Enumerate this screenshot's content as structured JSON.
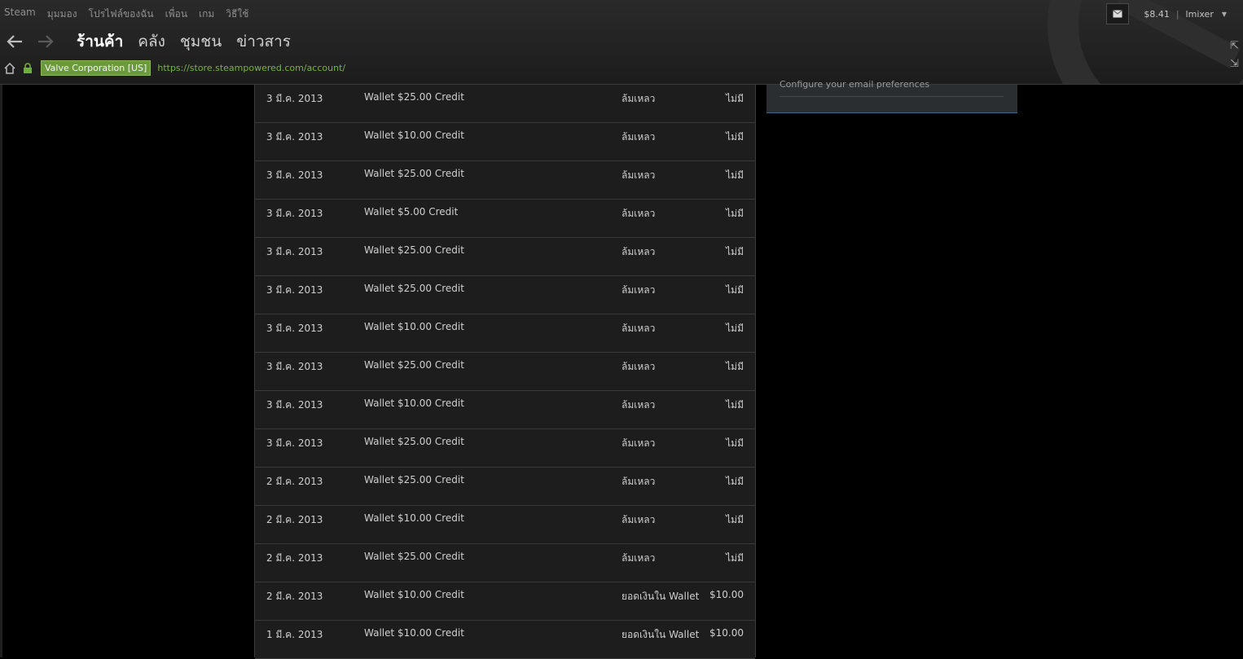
{
  "menubar": [
    "Steam",
    "มุมมอง",
    "โปรไฟล์ของฉัน",
    "เพื่อน",
    "เกม",
    "วิธีใช้"
  ],
  "account": {
    "balance": "$8.41",
    "separator": "|",
    "username": "lmixer"
  },
  "nav": {
    "tabs": [
      "ร้านค้า",
      "คลัง",
      "ชุมชน",
      "ข่าวสาร"
    ]
  },
  "urlbar": {
    "cert": "Valve Corporation [US]",
    "url": "https://store.steampowered.com/account/"
  },
  "right_panel": {
    "text": "Configure your email preferences"
  },
  "transactions": [
    {
      "date": "3 มี.ค. 2013",
      "item": "Wallet $25.00 Credit",
      "status": "ล้มเหลว",
      "amount": "ไม่มี"
    },
    {
      "date": "3 มี.ค. 2013",
      "item": "Wallet $10.00 Credit",
      "status": "ล้มเหลว",
      "amount": "ไม่มี"
    },
    {
      "date": "3 มี.ค. 2013",
      "item": "Wallet $25.00 Credit",
      "status": "ล้มเหลว",
      "amount": "ไม่มี"
    },
    {
      "date": "3 มี.ค. 2013",
      "item": "Wallet $5.00 Credit",
      "status": "ล้มเหลว",
      "amount": "ไม่มี"
    },
    {
      "date": "3 มี.ค. 2013",
      "item": "Wallet $25.00 Credit",
      "status": "ล้มเหลว",
      "amount": "ไม่มี"
    },
    {
      "date": "3 มี.ค. 2013",
      "item": "Wallet $25.00 Credit",
      "status": "ล้มเหลว",
      "amount": "ไม่มี"
    },
    {
      "date": "3 มี.ค. 2013",
      "item": "Wallet $10.00 Credit",
      "status": "ล้มเหลว",
      "amount": "ไม่มี"
    },
    {
      "date": "3 มี.ค. 2013",
      "item": "Wallet $25.00 Credit",
      "status": "ล้มเหลว",
      "amount": "ไม่มี"
    },
    {
      "date": "3 มี.ค. 2013",
      "item": "Wallet $10.00 Credit",
      "status": "ล้มเหลว",
      "amount": "ไม่มี"
    },
    {
      "date": "3 มี.ค. 2013",
      "item": "Wallet $25.00 Credit",
      "status": "ล้มเหลว",
      "amount": "ไม่มี"
    },
    {
      "date": "2 มี.ค. 2013",
      "item": "Wallet $25.00 Credit",
      "status": "ล้มเหลว",
      "amount": "ไม่มี"
    },
    {
      "date": "2 มี.ค. 2013",
      "item": "Wallet $10.00 Credit",
      "status": "ล้มเหลว",
      "amount": "ไม่มี"
    },
    {
      "date": "2 มี.ค. 2013",
      "item": "Wallet $25.00 Credit",
      "status": "ล้มเหลว",
      "amount": "ไม่มี"
    },
    {
      "date": "2 มี.ค. 2013",
      "item": "Wallet $10.00 Credit",
      "status": "ยอดเงินใน Wallet",
      "amount": "$10.00"
    },
    {
      "date": "1 มี.ค. 2013",
      "item": "Wallet $10.00 Credit",
      "status": "ยอดเงินใน Wallet",
      "amount": "$10.00"
    }
  ],
  "colors": {
    "cert_bg": "#6b9a3c",
    "url": "#7ab24a",
    "panel_accent": "#3a6b8c"
  }
}
